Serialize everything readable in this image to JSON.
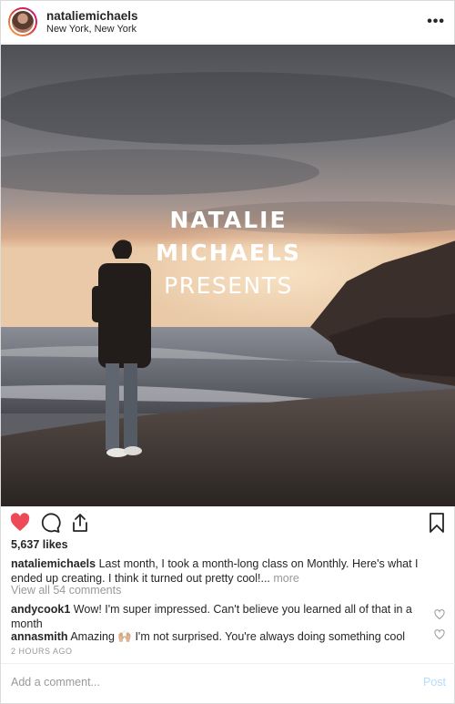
{
  "header": {
    "username": "nataliemichaels",
    "location": "New York, New York",
    "more_label": "•••"
  },
  "image": {
    "overlay_line1": "NATALIE",
    "overlay_line2": "MICHAELS",
    "overlay_line3": "PRESENTS"
  },
  "actions": {
    "liked": true,
    "icons": [
      "heart-icon",
      "comment-icon",
      "share-icon",
      "bookmark-icon"
    ]
  },
  "likes": "5,637 likes",
  "caption": {
    "username": "nataliemichaels",
    "text": "Last month, I took a month-long class on Monthly. Here's what I ended up creating. I think it turned out pretty cool!...",
    "more": "more"
  },
  "view_comments": "View all 54 comments",
  "comments": [
    {
      "username": "andycook1",
      "text": "Wow! I'm super impressed. Can't believe you learned all of that in a month"
    },
    {
      "username": "annasmith",
      "text": "Amazing 🙌🏼 I'm not surprised. You're always doing something cool"
    }
  ],
  "timestamp": "2 HOURS AGO",
  "comment_box": {
    "placeholder": "Add a comment...",
    "post_label": "Post"
  },
  "colors": {
    "heart": "#ed4956",
    "muted": "#999999",
    "post_button": "#b3dbff"
  }
}
